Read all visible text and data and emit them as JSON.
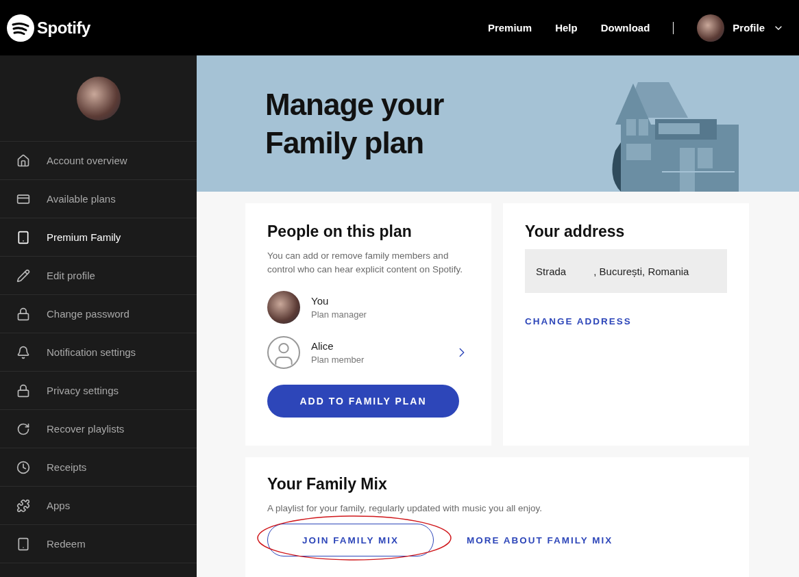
{
  "header": {
    "logo": "Spotify",
    "nav": [
      "Premium",
      "Help",
      "Download"
    ],
    "profile": "Profile"
  },
  "sidebar": {
    "items": [
      {
        "label": "Account overview",
        "selected": false
      },
      {
        "label": "Available plans",
        "selected": false
      },
      {
        "label": "Premium Family",
        "selected": true
      },
      {
        "label": "Edit profile",
        "selected": false
      },
      {
        "label": "Change password",
        "selected": false
      },
      {
        "label": "Notification settings",
        "selected": false
      },
      {
        "label": "Privacy settings",
        "selected": false
      },
      {
        "label": "Recover playlists",
        "selected": false
      },
      {
        "label": "Receipts",
        "selected": false
      },
      {
        "label": "Apps",
        "selected": false
      },
      {
        "label": "Redeem",
        "selected": false
      }
    ]
  },
  "hero": {
    "title": "Manage your Family plan"
  },
  "people_card": {
    "title": "People on this plan",
    "description": "You can add or remove family members and control who can hear explicit content on Spotify.",
    "members": [
      {
        "name": "You",
        "role": "Plan manager",
        "kind": "photo"
      },
      {
        "name": "Alice",
        "role": "Plan member",
        "kind": "placeholder"
      }
    ],
    "button": "ADD TO FAMILY PLAN"
  },
  "address_card": {
    "title": "Your address",
    "street": "Strada",
    "rest": ", București, Romania",
    "link": "CHANGE ADDRESS"
  },
  "family_mix": {
    "title": "Your Family Mix",
    "description": "A playlist for your family, regularly updated with music you all enjoy.",
    "join_button": "JOIN FAMILY MIX",
    "join_highlighted": true,
    "link": "MORE ABOUT FAMILY MIX"
  }
}
